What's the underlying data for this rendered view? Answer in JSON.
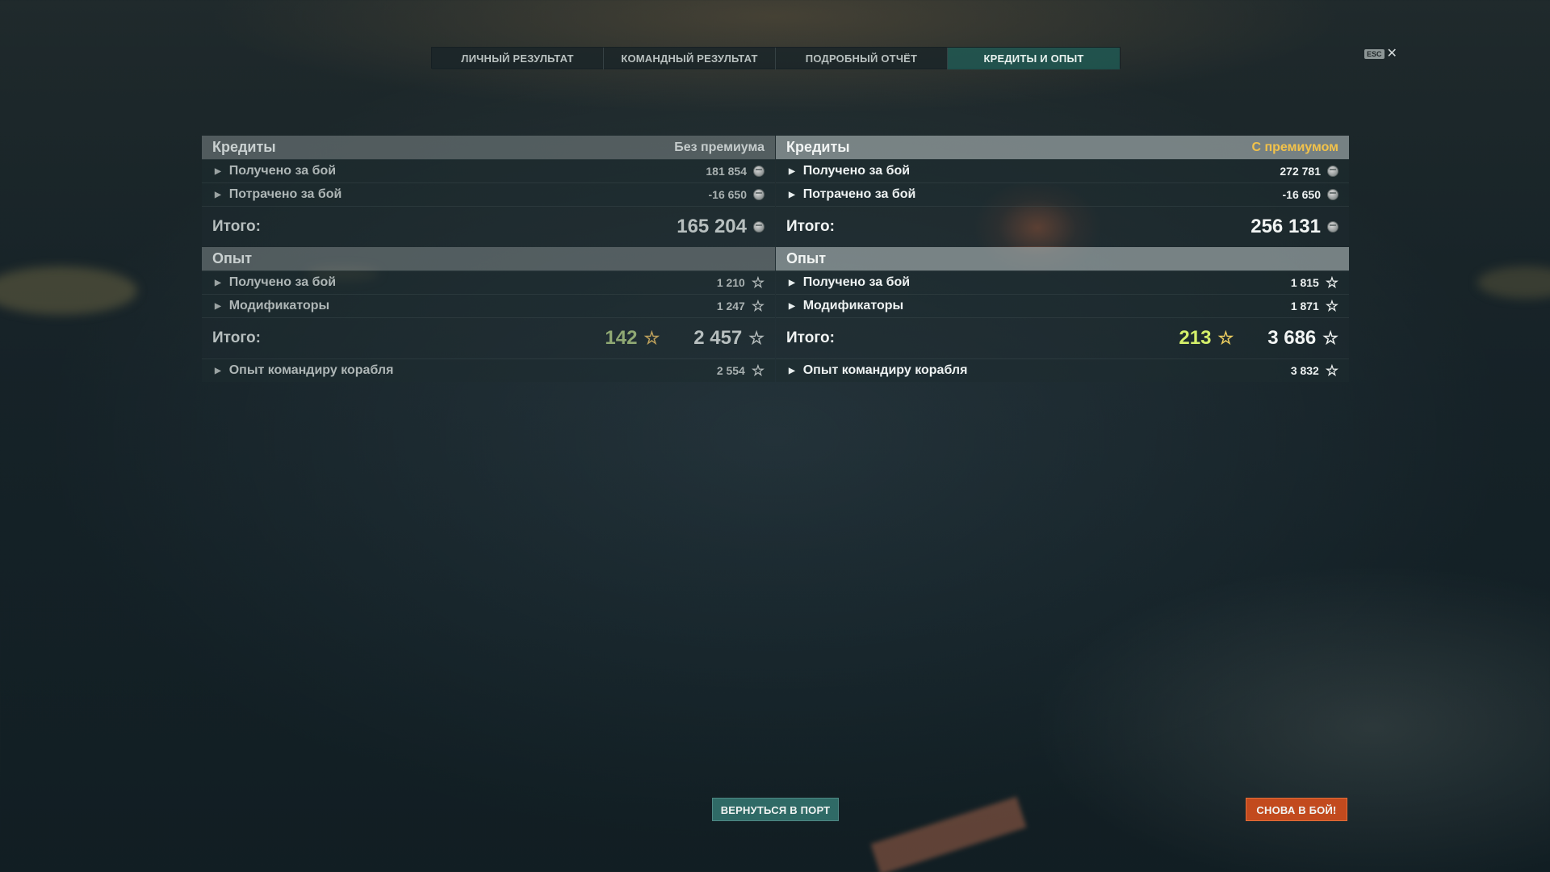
{
  "tabs": [
    {
      "label": "ЛИЧНЫЙ РЕЗУЛЬТАТ",
      "active": false
    },
    {
      "label": "КОМАНДНЫЙ РЕЗУЛЬТАТ",
      "active": false
    },
    {
      "label": "ПОДРОБНЫЙ ОТЧЁТ",
      "active": false
    },
    {
      "label": "КРЕДИТЫ И ОПЫТ",
      "active": true
    }
  ],
  "close": {
    "key_label": "ESC",
    "icon": "close-icon"
  },
  "left": {
    "credits": {
      "title": "Кредиты",
      "subtitle": "Без премиума",
      "earned": {
        "label": "Получено за бой",
        "value": "181 854"
      },
      "spent": {
        "label": "Потрачено за бой",
        "value": "-16 650"
      },
      "total": {
        "label": "Итого:",
        "value": "165 204"
      }
    },
    "experience": {
      "title": "Опыт",
      "earned": {
        "label": "Получено за бой",
        "value": "1 210"
      },
      "modifiers": {
        "label": "Модификаторы",
        "value": "1 247"
      },
      "total": {
        "label": "Итого:",
        "bonus": "142",
        "value": "2 457"
      },
      "commander": {
        "label": "Опыт командиру корабля",
        "value": "2 554"
      }
    }
  },
  "right": {
    "credits": {
      "title": "Кредиты",
      "subtitle": "С премиумом",
      "earned": {
        "label": "Получено за бой",
        "value": "272 781"
      },
      "spent": {
        "label": "Потрачено за бой",
        "value": "-16 650"
      },
      "total": {
        "label": "Итого:",
        "value": "256 131"
      }
    },
    "experience": {
      "title": "Опыт",
      "earned": {
        "label": "Получено за бой",
        "value": "1 815"
      },
      "modifiers": {
        "label": "Модификаторы",
        "value": "1 871"
      },
      "total": {
        "label": "Итого:",
        "bonus": "213",
        "value": "3 686"
      },
      "commander": {
        "label": "Опыт командиру корабля",
        "value": "3 832"
      }
    }
  },
  "buttons": {
    "port": "ВЕРНУТЬСЯ В ПОРТ",
    "battle": "СНОВА В БОЙ!"
  },
  "colors": {
    "active_tab": "#205852",
    "premium_label": "#f2c24a",
    "battle_button": "#c24a1e",
    "port_button": "#2f6a66"
  }
}
